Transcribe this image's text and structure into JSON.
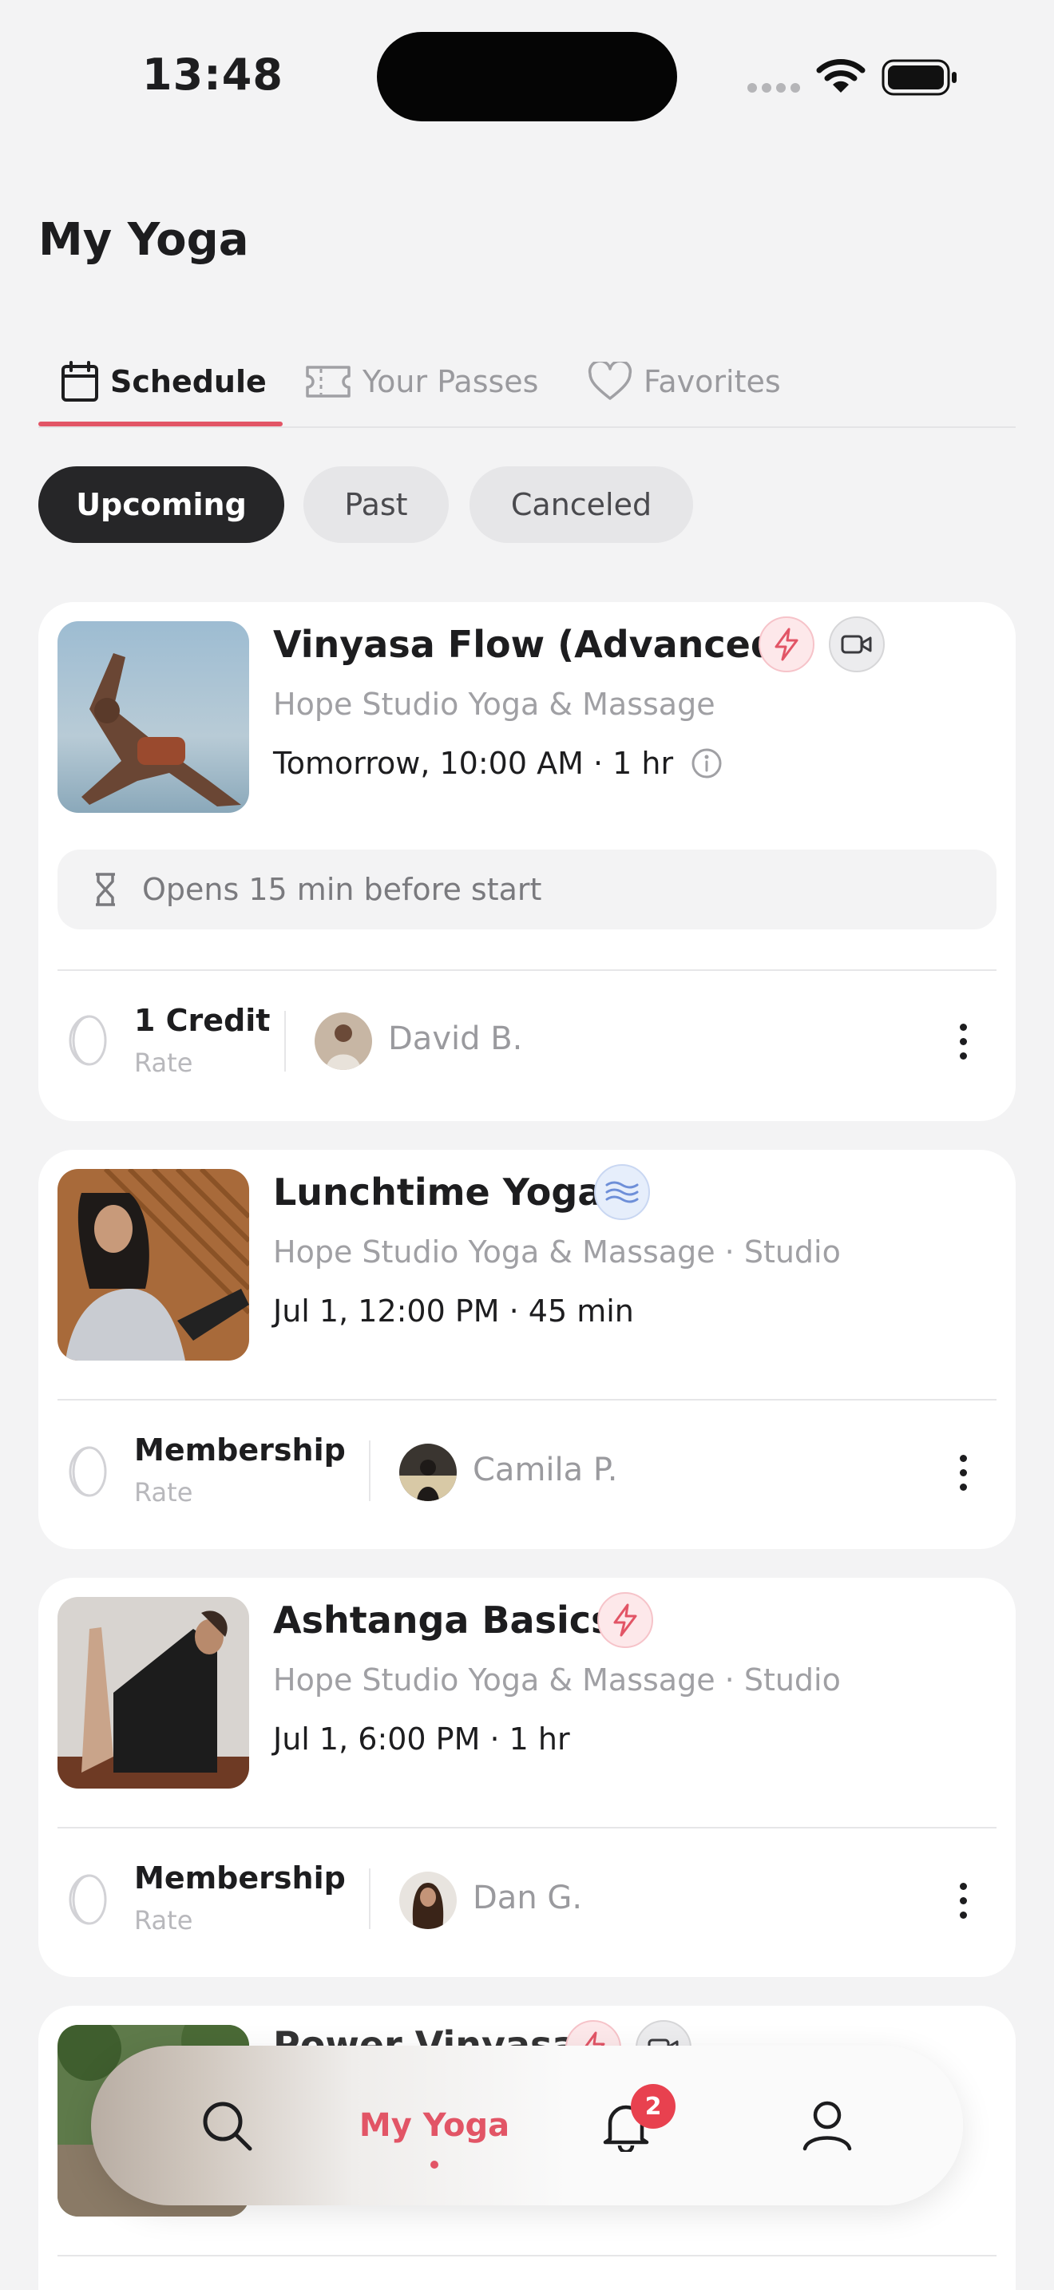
{
  "status_bar": {
    "time": "13:48"
  },
  "header": {
    "title": "My Yoga"
  },
  "tabs": [
    {
      "label": "Schedule",
      "icon": "calendar-icon",
      "active": true
    },
    {
      "label": "Your Passes",
      "icon": "ticket-icon",
      "active": false
    },
    {
      "label": "Favorites",
      "icon": "heart-icon",
      "active": false
    }
  ],
  "filters": [
    {
      "label": "Upcoming",
      "active": true
    },
    {
      "label": "Past",
      "active": false
    },
    {
      "label": "Canceled",
      "active": false
    }
  ],
  "classes": [
    {
      "name": "Vinyasa Flow (Advanced)",
      "badges": [
        "lightning-icon",
        "video-camera-icon"
      ],
      "studio": "Hope Studio Yoga & Massage",
      "when": "Tomorrow, 10:00 AM · 1 hr",
      "has_info": true,
      "notice": "Opens 15 min before start",
      "rate": "1 Credit",
      "rate_label": "Rate",
      "instructor": "David B."
    },
    {
      "name": "Lunchtime Yoga",
      "badges": [
        "waves-icon"
      ],
      "studio": "Hope Studio Yoga & Massage · Studio",
      "when": "Jul 1, 12:00 PM · 45 min",
      "rate": "Membership",
      "rate_label": "Rate",
      "instructor": "Camila P."
    },
    {
      "name": "Ashtanga Basics",
      "badges": [
        "lightning-icon"
      ],
      "studio": "Hope Studio Yoga & Massage · Studio",
      "when": "Jul 1, 6:00 PM · 1 hr",
      "rate": "Membership",
      "rate_label": "Rate",
      "instructor": "Dan G."
    },
    {
      "name": "Power Vinyasa",
      "badges": [
        "lightning-icon",
        "video-camera-icon"
      ]
    }
  ],
  "bottom_nav": {
    "items": [
      {
        "icon": "search-icon"
      },
      {
        "label": "My Yoga",
        "active": true
      },
      {
        "icon": "bell-icon",
        "badge": "2"
      },
      {
        "icon": "profile-icon"
      }
    ]
  },
  "colors": {
    "accent": "#e25566",
    "background": "#f3f3f4",
    "card": "#ffffff",
    "chip_active": "#262628",
    "badge_red": "#e8414f"
  }
}
